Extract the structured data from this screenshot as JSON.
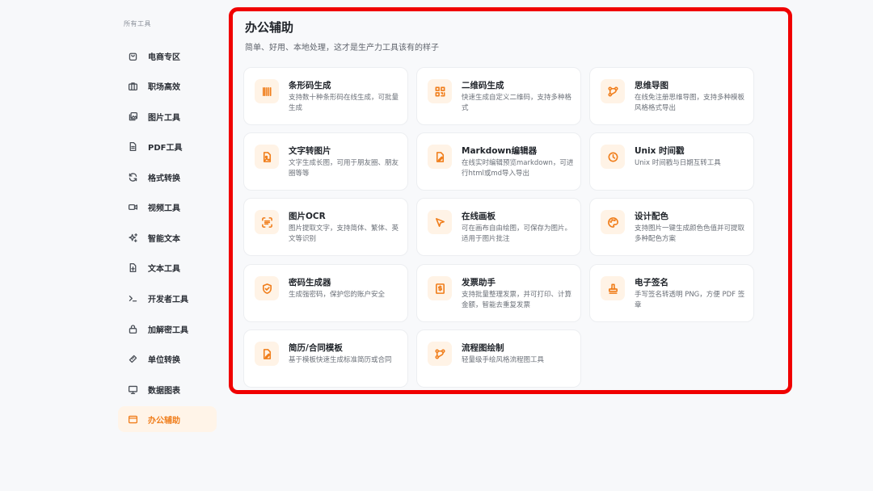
{
  "sidebar": {
    "heading": "所有工具",
    "items": [
      {
        "label": "电商专区",
        "icon": "shopping-bag-icon"
      },
      {
        "label": "职场高效",
        "icon": "briefcase-icon"
      },
      {
        "label": "图片工具",
        "icon": "images-icon"
      },
      {
        "label": "PDF工具",
        "icon": "document-icon"
      },
      {
        "label": "格式转换",
        "icon": "refresh-icon"
      },
      {
        "label": "视频工具",
        "icon": "video-camera-icon"
      },
      {
        "label": "智能文本",
        "icon": "sparkles-icon"
      },
      {
        "label": "文本工具",
        "icon": "file-text-icon"
      },
      {
        "label": "开发者工具",
        "icon": "terminal-icon"
      },
      {
        "label": "加解密工具",
        "icon": "lock-icon"
      },
      {
        "label": "单位转换",
        "icon": "ruler-icon"
      },
      {
        "label": "数据图表",
        "icon": "presentation-icon"
      },
      {
        "label": "办公辅助",
        "icon": "browser-window-icon",
        "active": true
      }
    ]
  },
  "main": {
    "title": "办公辅助",
    "subtitle": "简单、好用、本地处理，这才是生产力工具该有的样子",
    "cards": [
      {
        "title": "条形码生成",
        "desc": "支持数十种条形码在线生成，可批量生成",
        "icon": "barcode-icon"
      },
      {
        "title": "二维码生成",
        "desc": "快速生成自定义二维码，支持多种格式",
        "icon": "qrcode-icon"
      },
      {
        "title": "思维导图",
        "desc": "在线免注册思维导图，支持多种模板风格格式导出",
        "icon": "mindmap-icon"
      },
      {
        "title": "文字转图片",
        "desc": "文字生成长图，可用于朋友圈、朋友圈等等",
        "icon": "file-image-icon"
      },
      {
        "title": "Markdown编辑器",
        "desc": "在线实时编辑预览markdown，可进行html或md导入导出",
        "icon": "file-edit-icon"
      },
      {
        "title": "Unix 时间戳",
        "desc": "Unix 时间戳与日期互转工具",
        "icon": "clock-icon"
      },
      {
        "title": "图片OCR",
        "desc": "图片提取文字，支持简体、繁体、英文等识别",
        "icon": "scan-text-icon"
      },
      {
        "title": "在线画板",
        "desc": "可在画布自由绘图，可保存为图片。适用于图片批注",
        "icon": "cursor-pointer-icon"
      },
      {
        "title": "设计配色",
        "desc": "支持图片一键生成颜色色值并可提取多种配色方案",
        "icon": "palette-icon"
      },
      {
        "title": "密码生成器",
        "desc": "生成强密码，保护您的账户安全",
        "icon": "shield-check-icon"
      },
      {
        "title": "发票助手",
        "desc": "支持批量整理发票，并可打印、计算金额，智能去重复发票",
        "icon": "invoice-icon"
      },
      {
        "title": "电子签名",
        "desc": "手写签名转透明 PNG，方便 PDF 签章",
        "icon": "stamp-icon"
      },
      {
        "title": "简历/合同模板",
        "desc": "基于模板快速生成标准简历或合同",
        "icon": "file-edit-icon"
      },
      {
        "title": "流程图绘制",
        "desc": "轻量级手绘风格流程图工具",
        "icon": "mindmap-icon"
      }
    ]
  },
  "colors": {
    "accent": "#f07d1a",
    "highlight_border": "#f00000",
    "active_bg": "#fff4e8"
  }
}
